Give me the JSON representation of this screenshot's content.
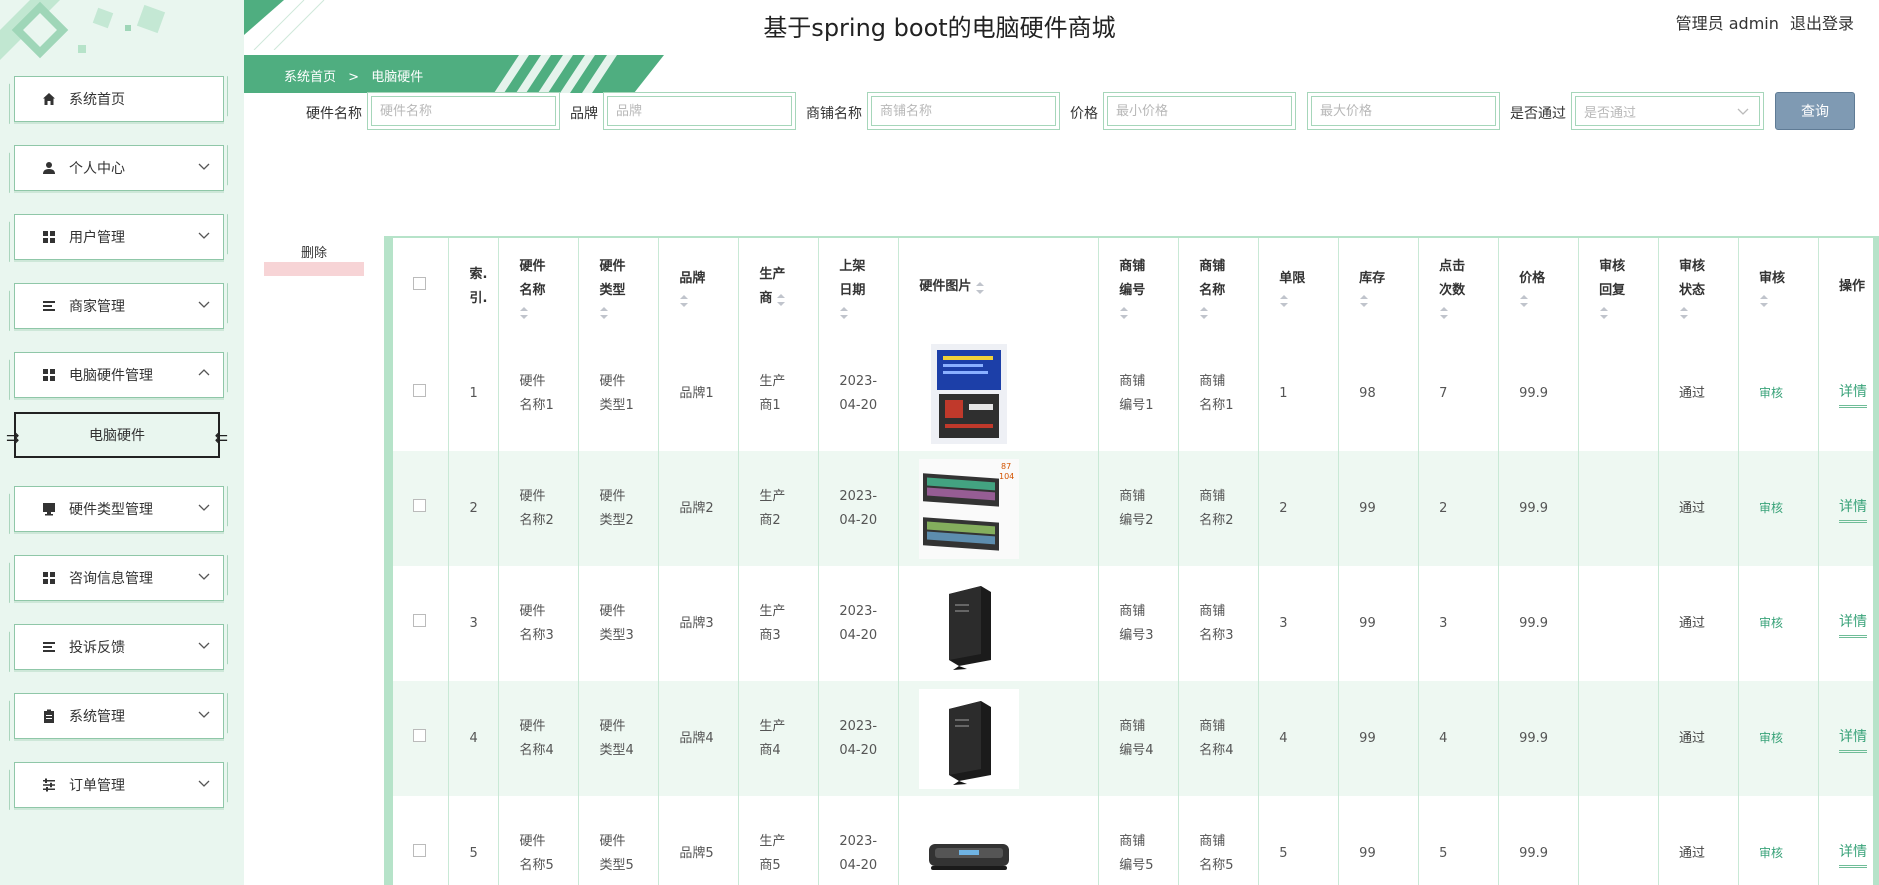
{
  "app": {
    "title": "基于spring boot的电脑硬件商城"
  },
  "user": {
    "role_name": "管理员 admin",
    "logout_label": "退出登录"
  },
  "breadcrumb": {
    "home": "系统首页",
    "separator": ">",
    "current": "电脑硬件"
  },
  "sidebar": {
    "items": [
      {
        "label": "系统首页",
        "icon": "home-icon",
        "expandable": false
      },
      {
        "label": "个人中心",
        "icon": "person-icon",
        "expandable": true
      },
      {
        "label": "用户管理",
        "icon": "grid-icon",
        "expandable": true
      },
      {
        "label": "商家管理",
        "icon": "list-icon",
        "expandable": true
      },
      {
        "label": "电脑硬件管理",
        "icon": "grid-icon",
        "expandable": true,
        "expanded": true
      },
      {
        "label": "硬件类型管理",
        "icon": "monitor-icon",
        "expandable": true
      },
      {
        "label": "咨询信息管理",
        "icon": "grid-icon",
        "expandable": true
      },
      {
        "label": "投诉反馈",
        "icon": "list-icon",
        "expandable": true
      },
      {
        "label": "系统管理",
        "icon": "clipboard-icon",
        "expandable": true
      },
      {
        "label": "订单管理",
        "icon": "sliders-icon",
        "expandable": true
      }
    ],
    "sub_item": "电脑硬件"
  },
  "search": {
    "name_label": "硬件名称",
    "name_placeholder": "硬件名称",
    "brand_label": "品牌",
    "brand_placeholder": "品牌",
    "shop_label": "商铺名称",
    "shop_placeholder": "商铺名称",
    "price_label": "价格",
    "min_placeholder": "最小价格",
    "max_placeholder": "最大价格",
    "passed_label": "是否通过",
    "passed_placeholder": "是否通过",
    "query_label": "查询"
  },
  "actions": {
    "delete_label": "删除"
  },
  "table": {
    "headers": {
      "index": [
        "索.",
        "引."
      ],
      "name": [
        "硬件",
        "名称"
      ],
      "type": [
        "硬件",
        "类型"
      ],
      "brand": [
        "品牌"
      ],
      "maker": [
        "生产",
        "商"
      ],
      "date": [
        "上架",
        "日期"
      ],
      "image": [
        "硬件图片"
      ],
      "shop_no": [
        "商铺",
        "编号"
      ],
      "shop_name": [
        "商铺",
        "名称"
      ],
      "limit": [
        "单限"
      ],
      "stock": [
        "库存"
      ],
      "clicks": [
        "点击",
        "次数"
      ],
      "price": [
        "价格"
      ],
      "reply": [
        "审核",
        "回复"
      ],
      "status": [
        "审核",
        "状态"
      ],
      "audit": [
        "审核"
      ],
      "op": [
        "操作"
      ]
    },
    "rows": [
      {
        "index": "1",
        "name": [
          "硬件",
          "名称1"
        ],
        "type": [
          "硬件",
          "类型1"
        ],
        "brand": "品牌1",
        "maker": [
          "生产",
          "商1"
        ],
        "date": [
          "2023-",
          "04-20"
        ],
        "image": "motherboard-photo",
        "shop_no": [
          "商铺",
          "编号1"
        ],
        "shop_name": [
          "商铺",
          "名称1"
        ],
        "limit": "1",
        "stock": "98",
        "clicks": "7",
        "price": "99.9",
        "reply": "",
        "status": "通过",
        "audit": "审核",
        "op": "详情"
      },
      {
        "index": "2",
        "name": [
          "硬件",
          "名称2"
        ],
        "type": [
          "硬件",
          "类型2"
        ],
        "brand": "品牌2",
        "maker": [
          "生产",
          "商2"
        ],
        "date": [
          "2023-",
          "04-20"
        ],
        "image": "keyboard-photo",
        "shop_no": [
          "商铺",
          "编号2"
        ],
        "shop_name": [
          "商铺",
          "名称2"
        ],
        "limit": "2",
        "stock": "99",
        "clicks": "2",
        "price": "99.9",
        "reply": "",
        "status": "通过",
        "audit": "审核",
        "op": "详情"
      },
      {
        "index": "3",
        "name": [
          "硬件",
          "名称3"
        ],
        "type": [
          "硬件",
          "类型3"
        ],
        "brand": "品牌3",
        "maker": [
          "生产",
          "商3"
        ],
        "date": [
          "2023-",
          "04-20"
        ],
        "image": "pc-case-photo",
        "shop_no": [
          "商铺",
          "编号3"
        ],
        "shop_name": [
          "商铺",
          "名称3"
        ],
        "limit": "3",
        "stock": "99",
        "clicks": "3",
        "price": "99.9",
        "reply": "",
        "status": "通过",
        "audit": "审核",
        "op": "详情"
      },
      {
        "index": "4",
        "name": [
          "硬件",
          "名称4"
        ],
        "type": [
          "硬件",
          "类型4"
        ],
        "brand": "品牌4",
        "maker": [
          "生产",
          "商4"
        ],
        "date": [
          "2023-",
          "04-20"
        ],
        "image": "pc-case-photo",
        "shop_no": [
          "商铺",
          "编号4"
        ],
        "shop_name": [
          "商铺",
          "名称4"
        ],
        "limit": "4",
        "stock": "99",
        "clicks": "4",
        "price": "99.9",
        "reply": "",
        "status": "通过",
        "audit": "审核",
        "op": "详情"
      },
      {
        "index": "5",
        "name": [
          "硬件",
          "名称5"
        ],
        "type": [
          "硬件",
          "类型5"
        ],
        "brand": "品牌5",
        "maker": [
          "生产",
          "商5"
        ],
        "date": [
          "2023-",
          "04-20"
        ],
        "image": "console-photo",
        "shop_no": [
          "商铺",
          "编号5"
        ],
        "shop_name": [
          "商铺",
          "名称5"
        ],
        "limit": "5",
        "stock": "99",
        "clicks": "5",
        "price": "99.9",
        "reply": "",
        "status": "通过",
        "audit": "审核",
        "op": "详情"
      }
    ],
    "badge_number": "87 104"
  },
  "colors": {
    "accent": "#4fae80",
    "sidebar_bg": "#e9f6ef",
    "query_btn": "#7f9ab3",
    "row_alt": "#eef8f2"
  }
}
